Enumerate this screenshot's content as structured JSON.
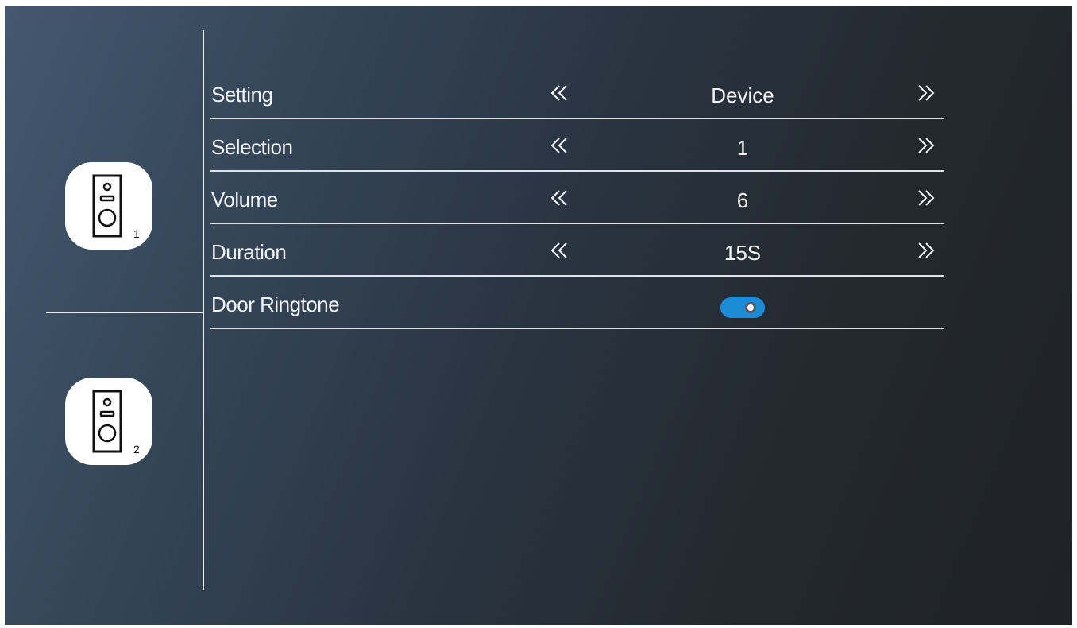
{
  "sidebar": {
    "devices": [
      {
        "number": "1"
      },
      {
        "number": "2"
      }
    ]
  },
  "settings": {
    "rows": [
      {
        "label": "Setting",
        "value": "Device",
        "icon_left": "double-chevron-left-icon",
        "icon_right": "double-chevron-right-icon"
      },
      {
        "label": "Selection",
        "value": "1",
        "icon_left": "double-chevron-left-icon",
        "icon_right": "double-chevron-right-icon"
      },
      {
        "label": "Volume",
        "value": "6",
        "icon_left": "double-chevron-left-icon",
        "icon_right": "double-chevron-right-icon"
      },
      {
        "label": "Duration",
        "value": "15S",
        "icon_left": "double-chevron-left-icon",
        "icon_right": "double-chevron-right-icon"
      }
    ],
    "door_ringtone": {
      "label": "Door Ringtone",
      "enabled": true
    }
  },
  "colors": {
    "toggle_on": "#1e8bd6",
    "text": "#f2f4f6",
    "divider": "#dde3e8"
  }
}
